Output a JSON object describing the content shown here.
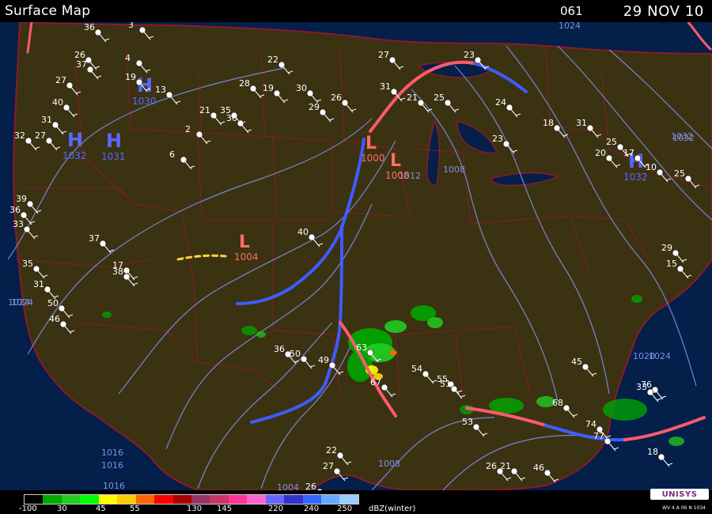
{
  "header": {
    "title": "Surface Map",
    "code": "061",
    "date": "29 NOV 10"
  },
  "colors": {
    "ocean": "#041f49",
    "land": "#3b3212",
    "coast": "#8b1a2a",
    "isobar": "#7f8fe6",
    "cold_front": "#3f5cff",
    "warm_front": "#ff5a6e",
    "high": "#5868ff",
    "low": "#ff6f61",
    "station": "#ffffff"
  },
  "pressure_centers": [
    {
      "type": "H",
      "pressure": "1032",
      "label": "H"
    },
    {
      "type": "H",
      "pressure": "1031",
      "label": "H"
    },
    {
      "type": "H",
      "pressure": "1030",
      "label": "H"
    },
    {
      "type": "L",
      "pressure": "1000",
      "label": "L"
    },
    {
      "type": "L",
      "pressure": "1004",
      "label": "L"
    },
    {
      "type": "H",
      "pressure": "1032",
      "label": "H"
    },
    {
      "type": "L",
      "pressure": "1008",
      "label": "L"
    }
  ],
  "isobar_labels": [
    "1024",
    "1024",
    "1032",
    "1008",
    "1012",
    "1016",
    "1008",
    "1004",
    "1008",
    "1016",
    "1024",
    "1032",
    "1024",
    "1020",
    "1016"
  ],
  "stations": [
    "36",
    "26",
    "37",
    "27",
    "40",
    "31",
    "27",
    "32",
    "39",
    "36",
    "33",
    "35",
    "31",
    "50",
    "46",
    "37",
    "17",
    "38",
    "3",
    "4",
    "19",
    "13",
    "6",
    "2",
    "21",
    "35",
    "30",
    "28",
    "19",
    "22",
    "30",
    "29",
    "26",
    "27",
    "31",
    "21",
    "25",
    "23",
    "24",
    "23",
    "18",
    "31",
    "25",
    "20",
    "17",
    "10",
    "25",
    "29",
    "15",
    "40",
    "36",
    "50",
    "49",
    "63",
    "67",
    "54",
    "55",
    "68",
    "74",
    "77",
    "76",
    "33",
    "18",
    "21",
    "26",
    "26",
    "27",
    "22",
    "51",
    "53",
    "46",
    "45"
  ],
  "legend": {
    "labels": [
      "-100",
      "30",
      "45",
      "55",
      "130",
      "145",
      "220",
      "240",
      "250",
      "dBZ(winter)"
    ],
    "colors": [
      "#000000",
      "#00aa00",
      "#22cc22",
      "#00ff00",
      "#ffff00",
      "#ffcc00",
      "#ff6600",
      "#ff0000",
      "#aa0000",
      "#993366",
      "#cc3366",
      "#ff3399",
      "#ff66cc",
      "#6666ff",
      "#3333cc",
      "#3366ff",
      "#66aaff",
      "#99ccff"
    ]
  },
  "logo": {
    "brand": "UNISYS",
    "small_text": "WV 4 A 06 N 1034"
  }
}
